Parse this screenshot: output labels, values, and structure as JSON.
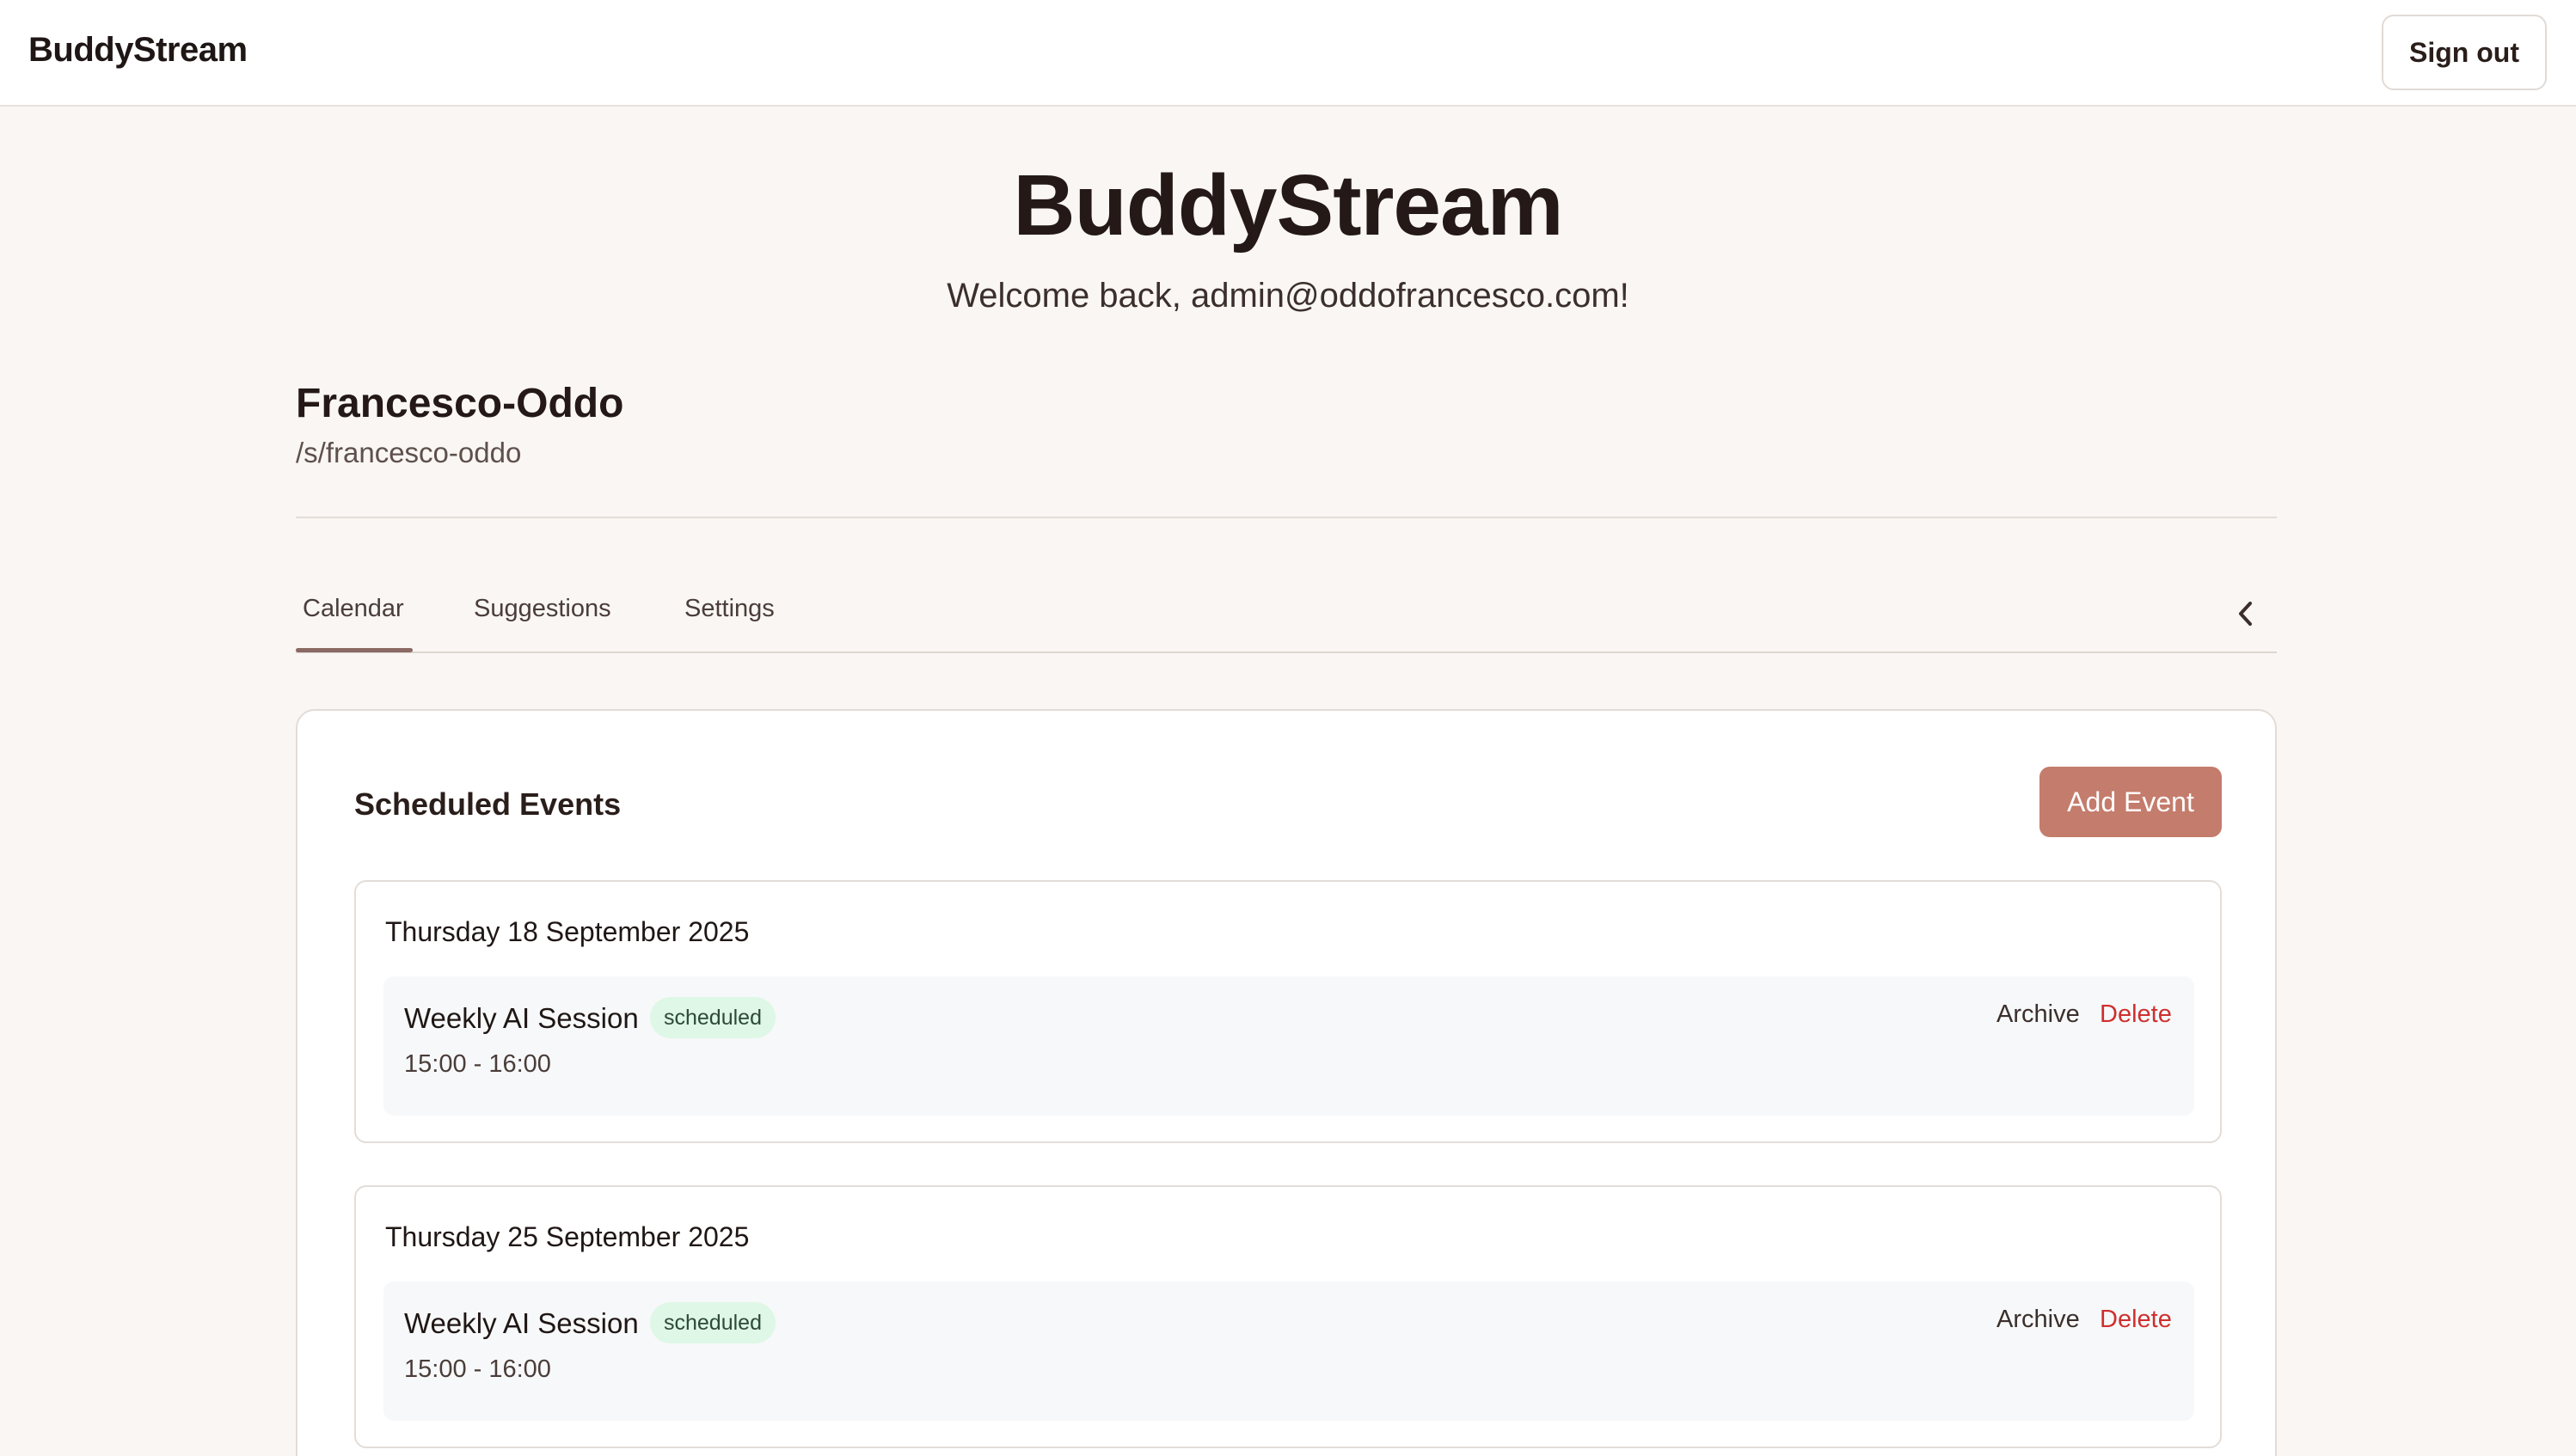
{
  "header": {
    "brand": "BuddyStream",
    "signout_label": "Sign out"
  },
  "hero": {
    "title": "BuddyStream",
    "welcome": "Welcome back, admin@oddofrancesco.com!"
  },
  "stream": {
    "name": "Francesco-Oddo",
    "path": "/s/francesco-oddo"
  },
  "tabs": [
    {
      "label": "Calendar",
      "active": true
    },
    {
      "label": "Suggestions",
      "active": false
    },
    {
      "label": "Settings",
      "active": false
    }
  ],
  "events_panel": {
    "title": "Scheduled Events",
    "add_label": "Add Event",
    "days": [
      {
        "date": "Thursday 18 September 2025",
        "event": {
          "name": "Weekly AI Session",
          "status": "scheduled",
          "time": "15:00 - 16:00",
          "archive_label": "Archive",
          "delete_label": "Delete"
        }
      },
      {
        "date": "Thursday 25 September 2025",
        "event": {
          "name": "Weekly AI Session",
          "status": "scheduled",
          "time": "15:00 - 16:00",
          "archive_label": "Archive",
          "delete_label": "Delete"
        }
      }
    ]
  },
  "colors": {
    "accent": "#c47c6c",
    "delete": "#cf2f2f",
    "badge_bg": "#def7e6",
    "page_bg": "#f9f6f3"
  },
  "icons": {
    "collapse": "chevron-left-icon"
  }
}
